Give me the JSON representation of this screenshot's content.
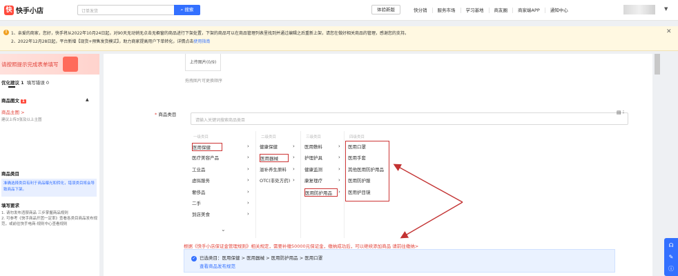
{
  "header": {
    "logo_text": "快手小店",
    "search_placeholder": "订单发货",
    "search_button": "搜索",
    "experience_button": "体验新版",
    "nav": [
      "快分销",
      "服务市场",
      "学习基地",
      "商友圈",
      "商家端APP",
      "通知中心"
    ]
  },
  "notice": {
    "line1": "1、亲爱的商家，您好，快手将从2022年10月24日起，对90天无动销无点击无橱窗的商品进行下架处置，下架的商品可以在商品管理列表里找到并通过编辑之后重新上架，请您在做好相关商品的管理，感谢您的支持。",
    "line2_prefix": "2、2022年12月28日起，平台新增【现货+预售发货模式】，助力商家提高用户下单转化，详情点击",
    "line2_link": "使用指南"
  },
  "sidebar": {
    "tip": "请按照提示完成表单填写",
    "optimize_label": "优化建议",
    "optimize_count": "1",
    "error_label": "填写错误",
    "error_count": "0",
    "goods_section": "商品图文",
    "goods_badge": "1",
    "main_image": "商品主图 >",
    "main_image_hint": "建议上传3张及以上主图",
    "category_title": "商品类目",
    "category_info": "准确选择类目有利于商品曝光和转化，错误类目将会导致商品下架。",
    "requirements_title": "填写要求",
    "requirements": [
      "1. 请勿发布违禁商品 三步掌握商品规则",
      "2. 可参考《快手商品开团一定率》查看各类目商品发布规范，或前往快手电商-规则中心查看规则"
    ]
  },
  "main": {
    "upload_label": "上传图片(0/9)",
    "drag_hint": "拖拽图片可更换顺序",
    "category_label": "商品类目",
    "category_placeholder": "请输入关键词搜索商品类目",
    "col_heads": [
      "一级类目",
      "二级类目",
      "三级类目",
      "四级类目"
    ],
    "level1": [
      "医用保健",
      "医疗美容产品",
      "工业品",
      "虚拟服务",
      "奢侈品",
      "二手",
      "到店美食"
    ],
    "level2": [
      "健康保健",
      "医用器械",
      "滋补养生原料",
      "OTC(非处方药)"
    ],
    "level3": [
      "医用敷料",
      "护理护具",
      "健康监测",
      "康复理疗",
      "医用防护用品"
    ],
    "level4": [
      "医用口罩",
      "医用手套",
      "其他医用防护用品",
      "医用防护服",
      "医用护目镜"
    ],
    "rule_text": "根据《快手小店保证金管理规则》相关规定，需要补缴50000元保证金，缴纳成功后，可以继续添加商品 请前往缴纳>",
    "selected_text": "已选类目：医用保健 > 医用器械 > 医用防护用品 > 医用口罩",
    "selected_link": "查看商品发布规范"
  },
  "icons": {
    "close": "close-icon",
    "warning": "warning-icon",
    "check": "check-icon"
  },
  "colors": {
    "accent": "#3370ff",
    "danger": "#e2443b",
    "highlight": "#c33333"
  }
}
